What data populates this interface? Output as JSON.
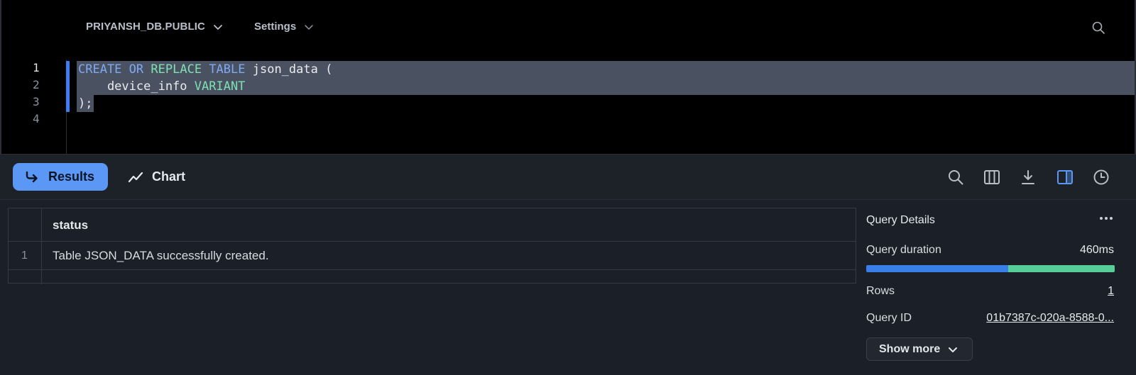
{
  "header": {
    "database_label": "PRIYANSH_DB.PUBLIC",
    "settings_label": "Settings"
  },
  "editor": {
    "line_numbers": [
      "1",
      "2",
      "3",
      "4"
    ],
    "lines": [
      [
        {
          "t": "CREATE",
          "c": "kw1"
        },
        {
          "t": " ",
          "c": ""
        },
        {
          "t": "OR",
          "c": "kw1"
        },
        {
          "t": " ",
          "c": ""
        },
        {
          "t": "REPLACE",
          "c": "kw2"
        },
        {
          "t": " ",
          "c": ""
        },
        {
          "t": "TABLE",
          "c": "kw1"
        },
        {
          "t": " json_data (",
          "c": ""
        }
      ],
      [
        {
          "t": "    device_info ",
          "c": ""
        },
        {
          "t": "VARIANT",
          "c": "kw2"
        }
      ],
      [
        {
          "t": ");",
          "c": ""
        }
      ],
      []
    ]
  },
  "results_toolbar": {
    "results_label": "Results",
    "chart_label": "Chart"
  },
  "table": {
    "columns": [
      "status"
    ],
    "rows": [
      {
        "index": "1",
        "status": "Table JSON_DATA successfully created."
      }
    ]
  },
  "details": {
    "title": "Query Details",
    "duration_label": "Query duration",
    "duration_value": "460ms",
    "duration_split": 0.57,
    "rows_label": "Rows",
    "rows_value": "1",
    "query_id_label": "Query ID",
    "query_id_value": "01b7387c-020a-8588-0...",
    "show_more_label": "Show more"
  },
  "colors": {
    "accent": "#5b97f4",
    "bar_primary": "#3a7ee8",
    "bar_secondary": "#57cd98"
  },
  "icons": {
    "results": "return-arrow-icon",
    "chart": "trend-line-icon",
    "toolbar": [
      "search-icon",
      "columns-icon",
      "download-icon",
      "side-panel-icon",
      "history-clock-icon"
    ]
  }
}
